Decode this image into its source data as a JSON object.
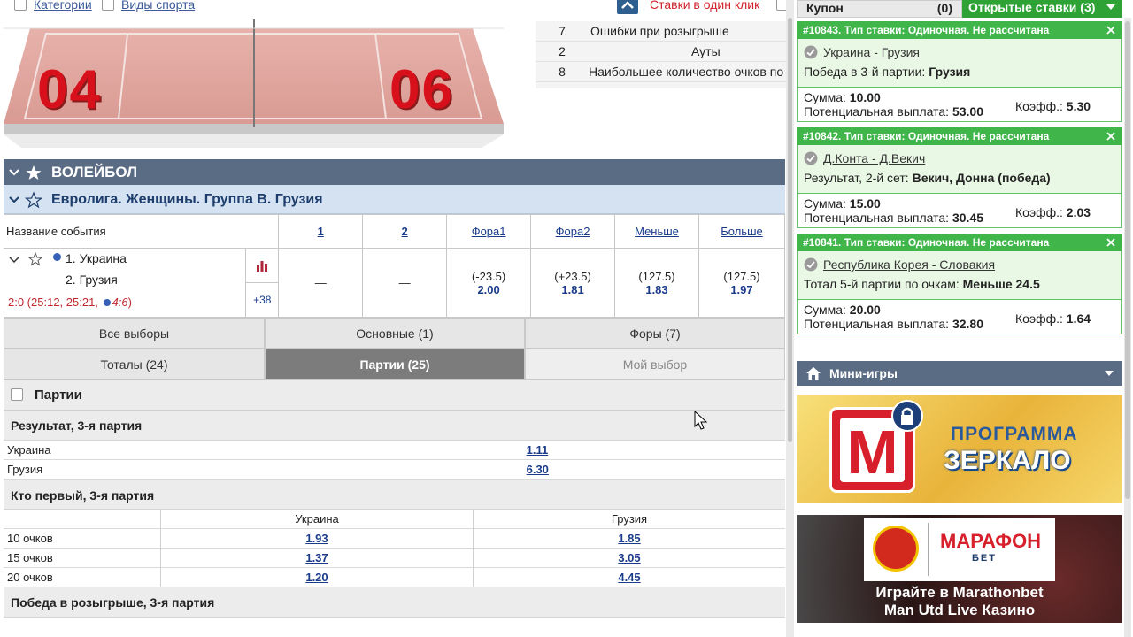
{
  "topbar": {
    "categories_label": "Категории",
    "sports_label": "Виды спорта",
    "one_click_label": "Ставки в один клик"
  },
  "court": {
    "score_left": "04",
    "score_right": "06"
  },
  "stats": [
    {
      "num": "7",
      "label": "Ошибки при розыгрыше"
    },
    {
      "num": "2",
      "label": "Ауты"
    },
    {
      "num": "8",
      "label": "Наибольшее количество очков по"
    }
  ],
  "sport": {
    "title": "ВОЛЕЙБОЛ"
  },
  "league": {
    "title": "Евролига. Женщины. Группа B. Грузия"
  },
  "event_table": {
    "col_event": "Название события",
    "col_1": "1",
    "col_2": "2",
    "col_fora1": "Фора1",
    "col_fora2": "Фора2",
    "col_less": "Меньше",
    "col_more": "Больше",
    "team1": "1. Украина",
    "team2": "2. Грузия",
    "score": "2:0 (25:12, 25:21, ",
    "score_live": "4:6",
    "score_close": ")",
    "more_markets": "+38",
    "v1": "—",
    "v2": "—",
    "fora1_line": "(-23.5)",
    "fora1_odds": "2.00",
    "fora2_line": "(+23.5)",
    "fora2_odds": "1.81",
    "less_line": "(127.5)",
    "less_odds": "1.83",
    "more_line": "(127.5)",
    "more_odds": "1.97"
  },
  "tabs": {
    "all": "Все выборы",
    "main": "Основные (1)",
    "foras": "Форы (7)",
    "totals": "Тоталы (24)",
    "sets": "Партии (25)",
    "my": "Мой выбор"
  },
  "section": {
    "title": "Партии"
  },
  "market1": {
    "title": "Результат, 3-я партия",
    "rows": [
      {
        "name": "Украина",
        "odds": "1.11"
      },
      {
        "name": "Грузия",
        "odds": "6.30"
      }
    ]
  },
  "market2": {
    "title": "Кто первый, 3-я партия",
    "col_a": "Украина",
    "col_b": "Грузия",
    "rows": [
      {
        "name": "10 очков",
        "a": "1.93",
        "b": "1.85"
      },
      {
        "name": "15 очков",
        "a": "1.37",
        "b": "3.05"
      },
      {
        "name": "20 очков",
        "a": "1.20",
        "b": "4.45"
      }
    ]
  },
  "market3": {
    "title": "Победа в розыгрыше, 3-я партия"
  },
  "right": {
    "coupon_label": "Купон",
    "coupon_count": "(0)",
    "open_bets_label": "Открытые ставки (3)",
    "bets": [
      {
        "header": "#10843. Тип ставки: Одиночная. Не рассчитана",
        "event": "Украина - Грузия",
        "sel_prefix": "Победа в 3-й партии: ",
        "sel_value": "Грузия",
        "sum_label": "Сумма: ",
        "sum": "10.00",
        "payout_label": "Потенциальная выплата: ",
        "payout": "53.00",
        "coef_label": "Коэфф.: ",
        "coef": "5.30"
      },
      {
        "header": "#10842. Тип ставки: Одиночная. Не рассчитана",
        "event": "Д.Конта - Д.Векич",
        "sel_prefix": "Результат, 2-й сет: ",
        "sel_value": "Векич, Донна (победа)",
        "sum_label": "Сумма: ",
        "sum": "15.00",
        "payout_label": "Потенциальная выплата: ",
        "payout": "30.45",
        "coef_label": "Коэфф.: ",
        "coef": "2.03"
      },
      {
        "header": "#10841. Тип ставки: Одиночная. Не рассчитана",
        "event": "Республика Корея - Словакия",
        "sel_prefix": "Тотал 5-й партии по очкам: ",
        "sel_value": "Меньше 24.5",
        "sum_label": "Сумма: ",
        "sum": "20.00",
        "payout_label": "Потенциальная выплата: ",
        "payout": "32.80",
        "coef_label": "Коэфф.: ",
        "coef": "1.64"
      }
    ],
    "minigames_label": "Мини-игры",
    "banner1_line1": "ПРОГРАММА",
    "banner1_line2": "ЗЕРКАЛО",
    "banner1_logo": "M",
    "banner2_brand": "МАРАФОН",
    "banner2_sub": "БЕТ",
    "banner2_line1": "Играйте в Marathonbet",
    "banner2_line2": "Man Utd Live Казино"
  }
}
